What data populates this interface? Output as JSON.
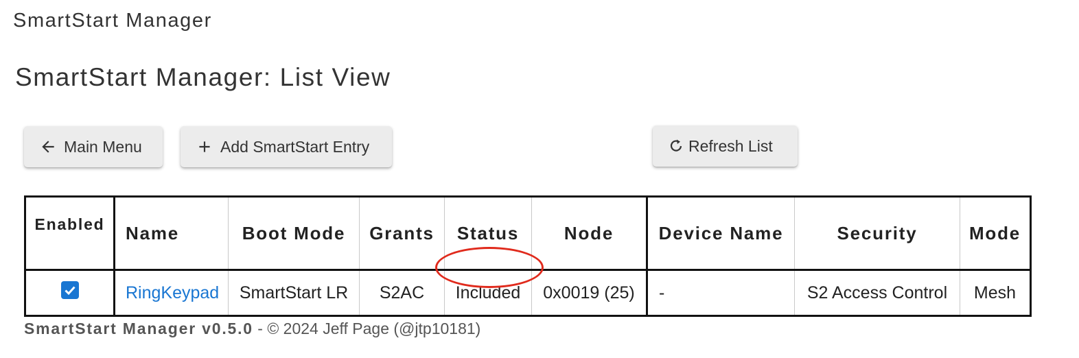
{
  "app": {
    "title": "SmartStart Manager"
  },
  "page": {
    "title": "SmartStart Manager: List View"
  },
  "toolbar": {
    "main_menu_label": "Main Menu",
    "main_menu_icon": "arrow-left-icon",
    "add_entry_label": "Add SmartStart Entry",
    "add_entry_icon": "plus-icon",
    "refresh_label": "Refresh List",
    "refresh_icon": "refresh-icon"
  },
  "table": {
    "columns": [
      "Enabled",
      "Name",
      "Boot Mode",
      "Grants",
      "Status",
      "Node",
      "Device Name",
      "Security",
      "Mode"
    ],
    "rows": [
      {
        "enabled": true,
        "name": "RingKeypad",
        "boot_mode": "SmartStart LR",
        "grants": "S2AC",
        "status": "Included",
        "node": "0x0019 (25)",
        "device_name": "-",
        "security": "S2 Access Control",
        "mode": "Mesh"
      }
    ]
  },
  "annotation": {
    "highlight_color": "#e02a1c"
  },
  "colors": {
    "link": "#1976d2",
    "checkbox": "#1976d2"
  },
  "footer": {
    "version": "SmartStart Manager v0.5.0",
    "copyright": " - © 2024 Jeff Page (@jtp10181)"
  }
}
